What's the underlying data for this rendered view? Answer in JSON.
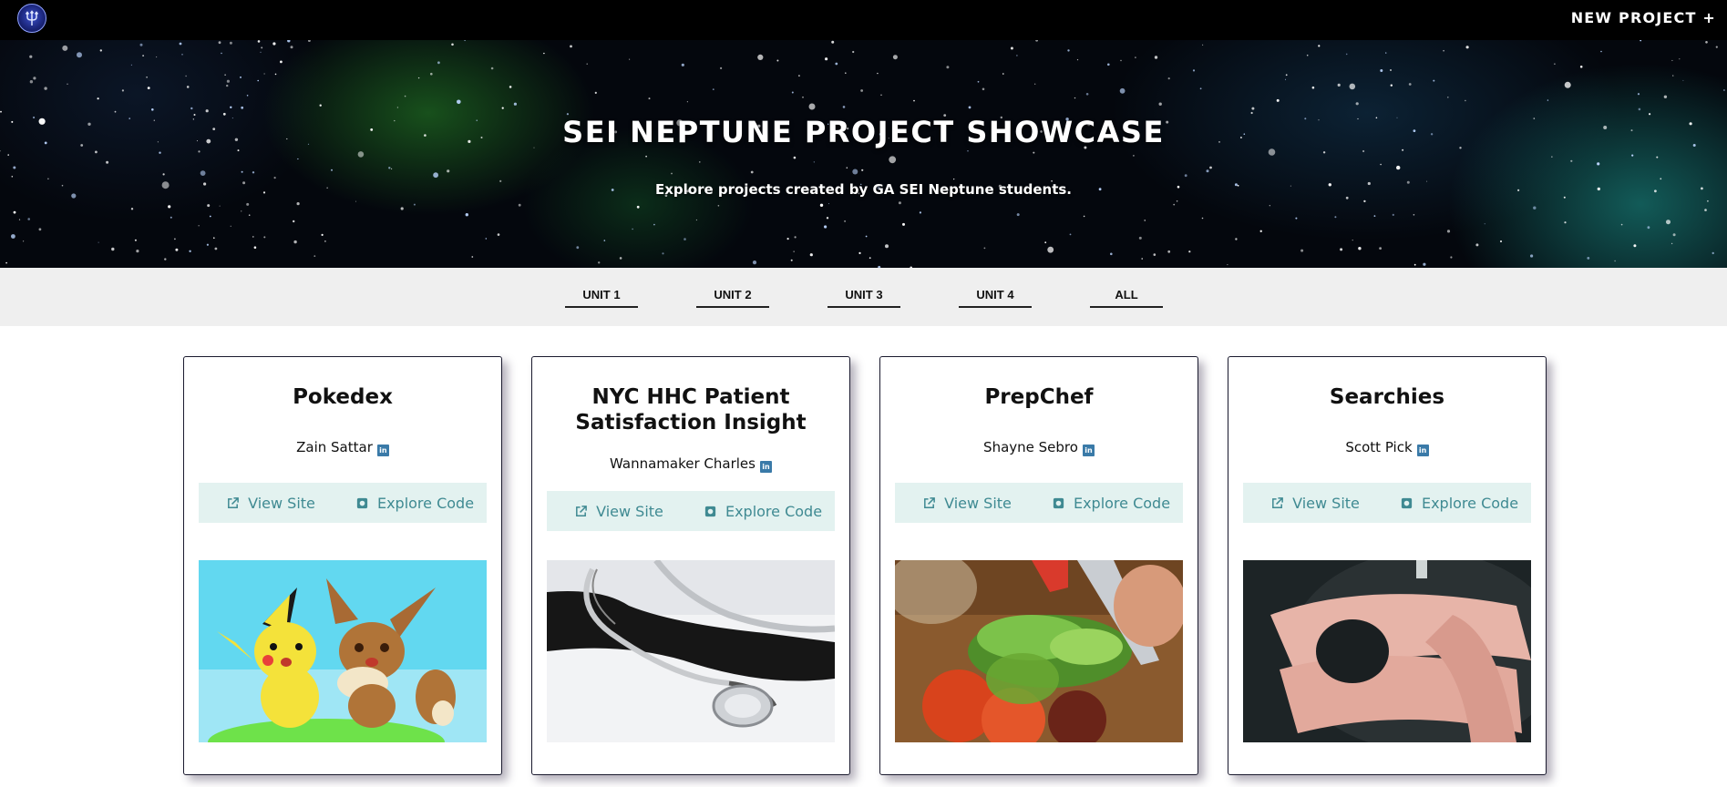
{
  "nav": {
    "new_project_label": "NEW PROJECT +"
  },
  "hero": {
    "title": "SEI NEPTUNE PROJECT SHOWCASE",
    "subtitle": "Explore projects created by GA SEI Neptune students."
  },
  "filters": [
    "UNIT 1",
    "UNIT 2",
    "UNIT 3",
    "UNIT 4",
    "ALL"
  ],
  "projects": [
    {
      "title": "Pokedex",
      "author": "Zain Sattar",
      "view_label": "View Site",
      "code_label": "Explore Code",
      "image": "pokemon-image"
    },
    {
      "title_line1": "NYC HHC Patient",
      "title_line2": "Satisfaction Insight",
      "author": "Wannamaker Charles",
      "view_label": "View Site",
      "code_label": "Explore Code",
      "image": "stethoscope-image"
    },
    {
      "title": "PrepChef",
      "author": "Shayne Sebro",
      "view_label": "View Site",
      "code_label": "Explore Code",
      "image": "cooking-image"
    },
    {
      "title": "Searchies",
      "author": "Scott Pick",
      "view_label": "View Site",
      "code_label": "Explore Code",
      "image": "tickets-image"
    }
  ],
  "icons": {
    "external_link": "external-link-icon",
    "code": "code-icon",
    "linkedin": "linkedin-icon"
  },
  "colors": {
    "nav_bg": "#000000",
    "filter_bg": "#efefef",
    "action_bg": "#e3f2f0",
    "action_text": "#3f8a92"
  }
}
